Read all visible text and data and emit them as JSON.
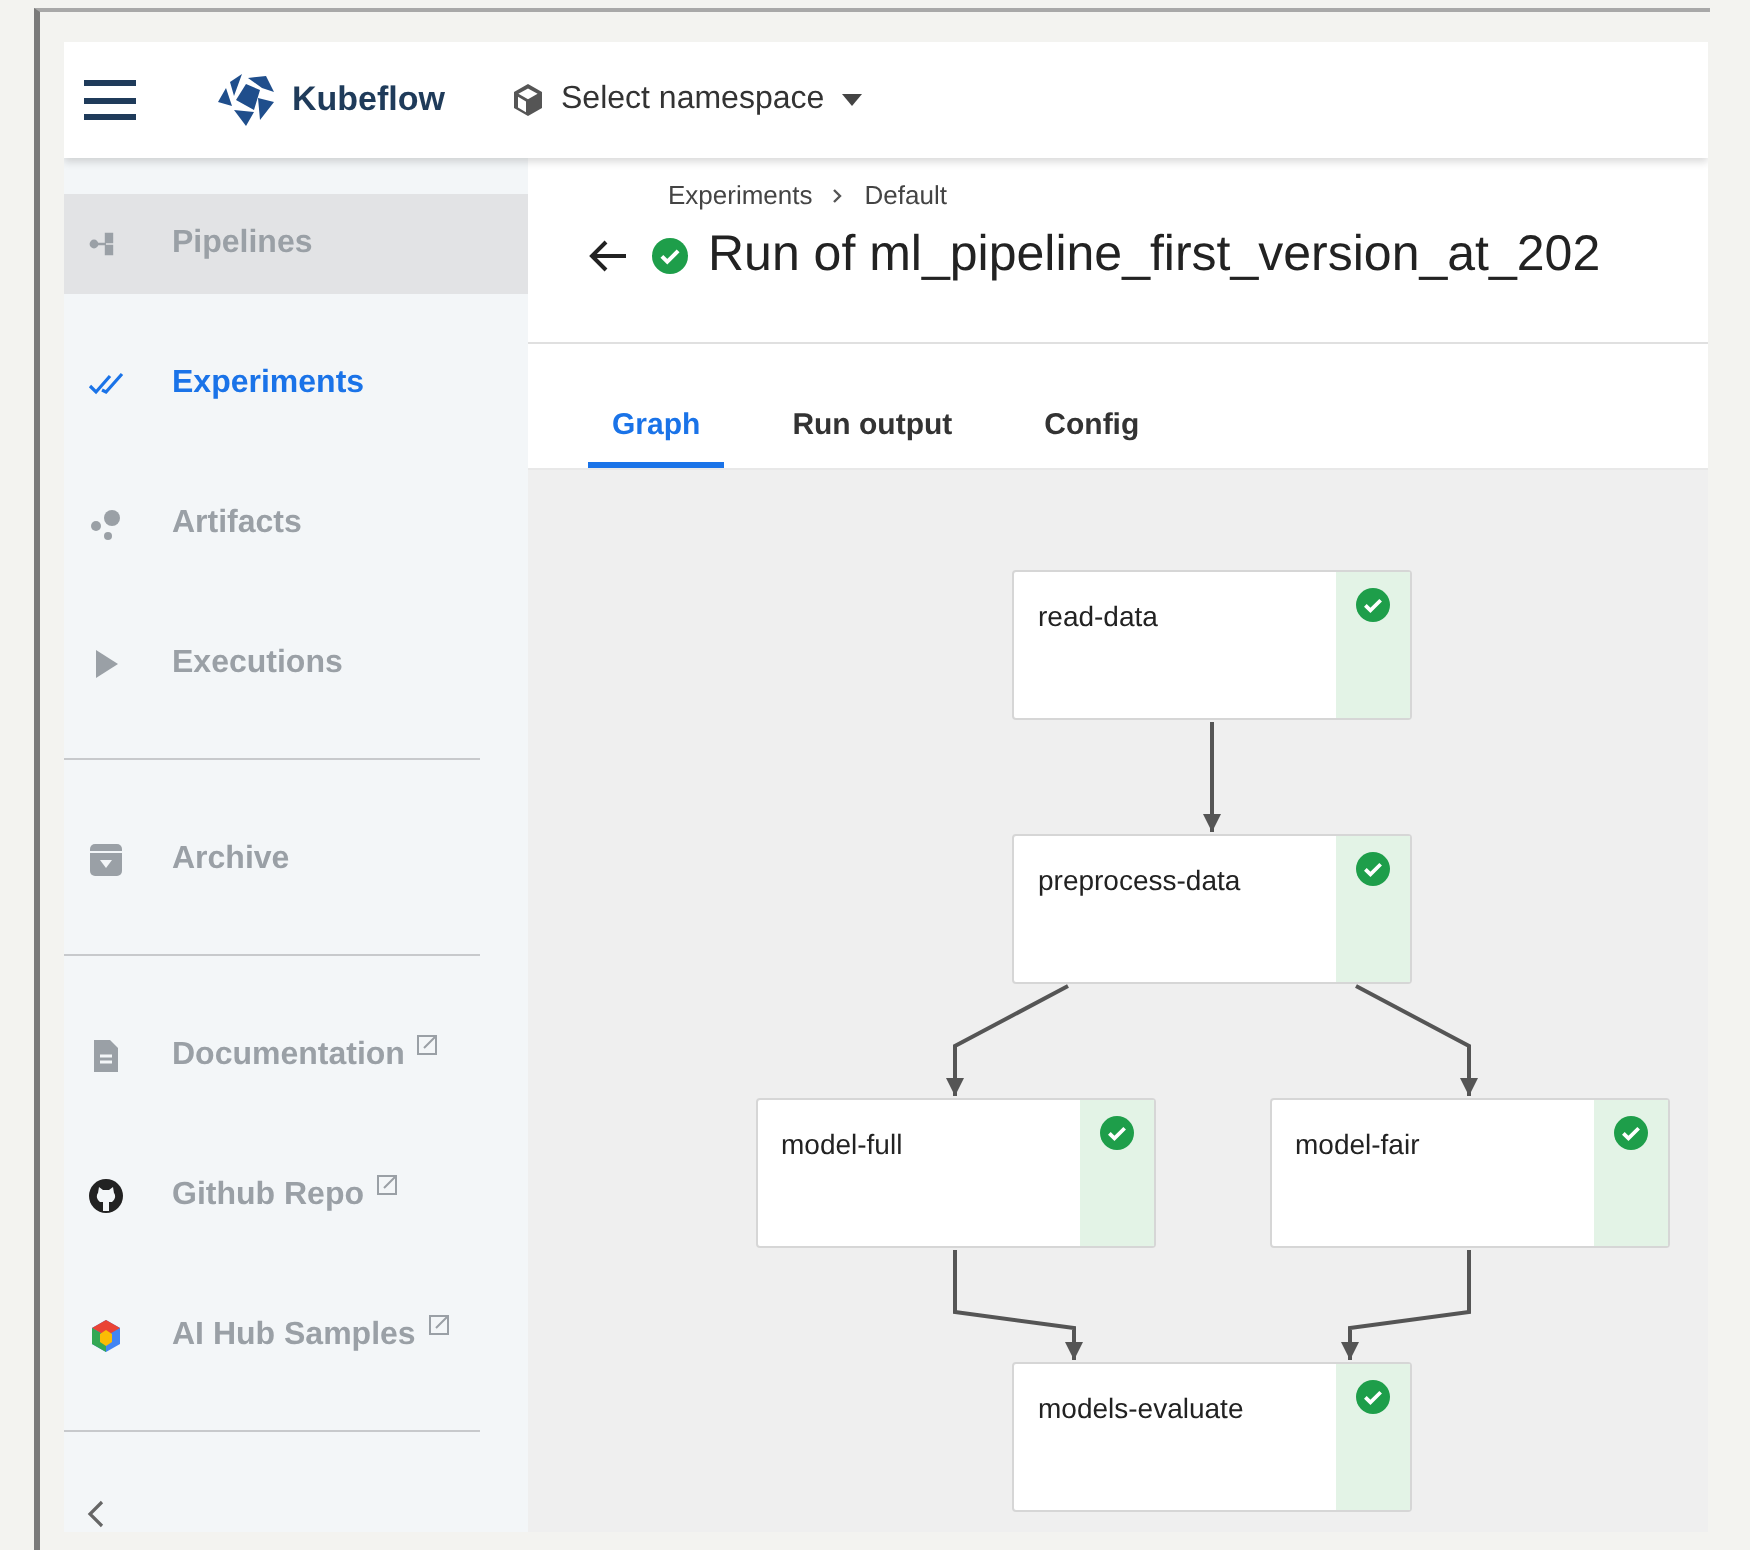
{
  "top_bar": {
    "brand": "Kubeflow",
    "namespace": {
      "label": "Select namespace"
    }
  },
  "sidebar": {
    "sections": [
      {
        "items": [
          {
            "label": "Pipelines",
            "selected": false,
            "highlighted": true,
            "external": false
          },
          {
            "label": "Experiments",
            "selected": true,
            "highlighted": false,
            "external": false
          },
          {
            "label": "Artifacts",
            "selected": false,
            "highlighted": false,
            "external": false
          },
          {
            "label": "Executions",
            "selected": false,
            "highlighted": false,
            "external": false
          }
        ]
      },
      {
        "items": [
          {
            "label": "Archive",
            "selected": false,
            "highlighted": false,
            "external": false
          }
        ]
      },
      {
        "items": [
          {
            "label": "Documentation",
            "selected": false,
            "highlighted": false,
            "external": true
          },
          {
            "label": "Github Repo",
            "selected": false,
            "highlighted": false,
            "external": true
          },
          {
            "label": "AI Hub Samples",
            "selected": false,
            "highlighted": false,
            "external": true
          }
        ]
      }
    ]
  },
  "breadcrumbs": [
    "Experiments",
    "Default"
  ],
  "page_title": {
    "text": "Run of ml_pipeline_first_version_at_202",
    "succeeded": true
  },
  "tabs": [
    {
      "label": "Graph",
      "selected": true
    },
    {
      "label": "Run output",
      "selected": false
    },
    {
      "label": "Config",
      "selected": false
    }
  ],
  "graph": {
    "nodes": [
      {
        "label": "read-data",
        "succeeded": true
      },
      {
        "label": "preprocess-data",
        "succeeded": true
      },
      {
        "label": "model-full",
        "succeeded": true
      },
      {
        "label": "model-fair",
        "succeeded": true
      },
      {
        "label": "models-evaluate",
        "succeeded": true
      }
    ]
  }
}
